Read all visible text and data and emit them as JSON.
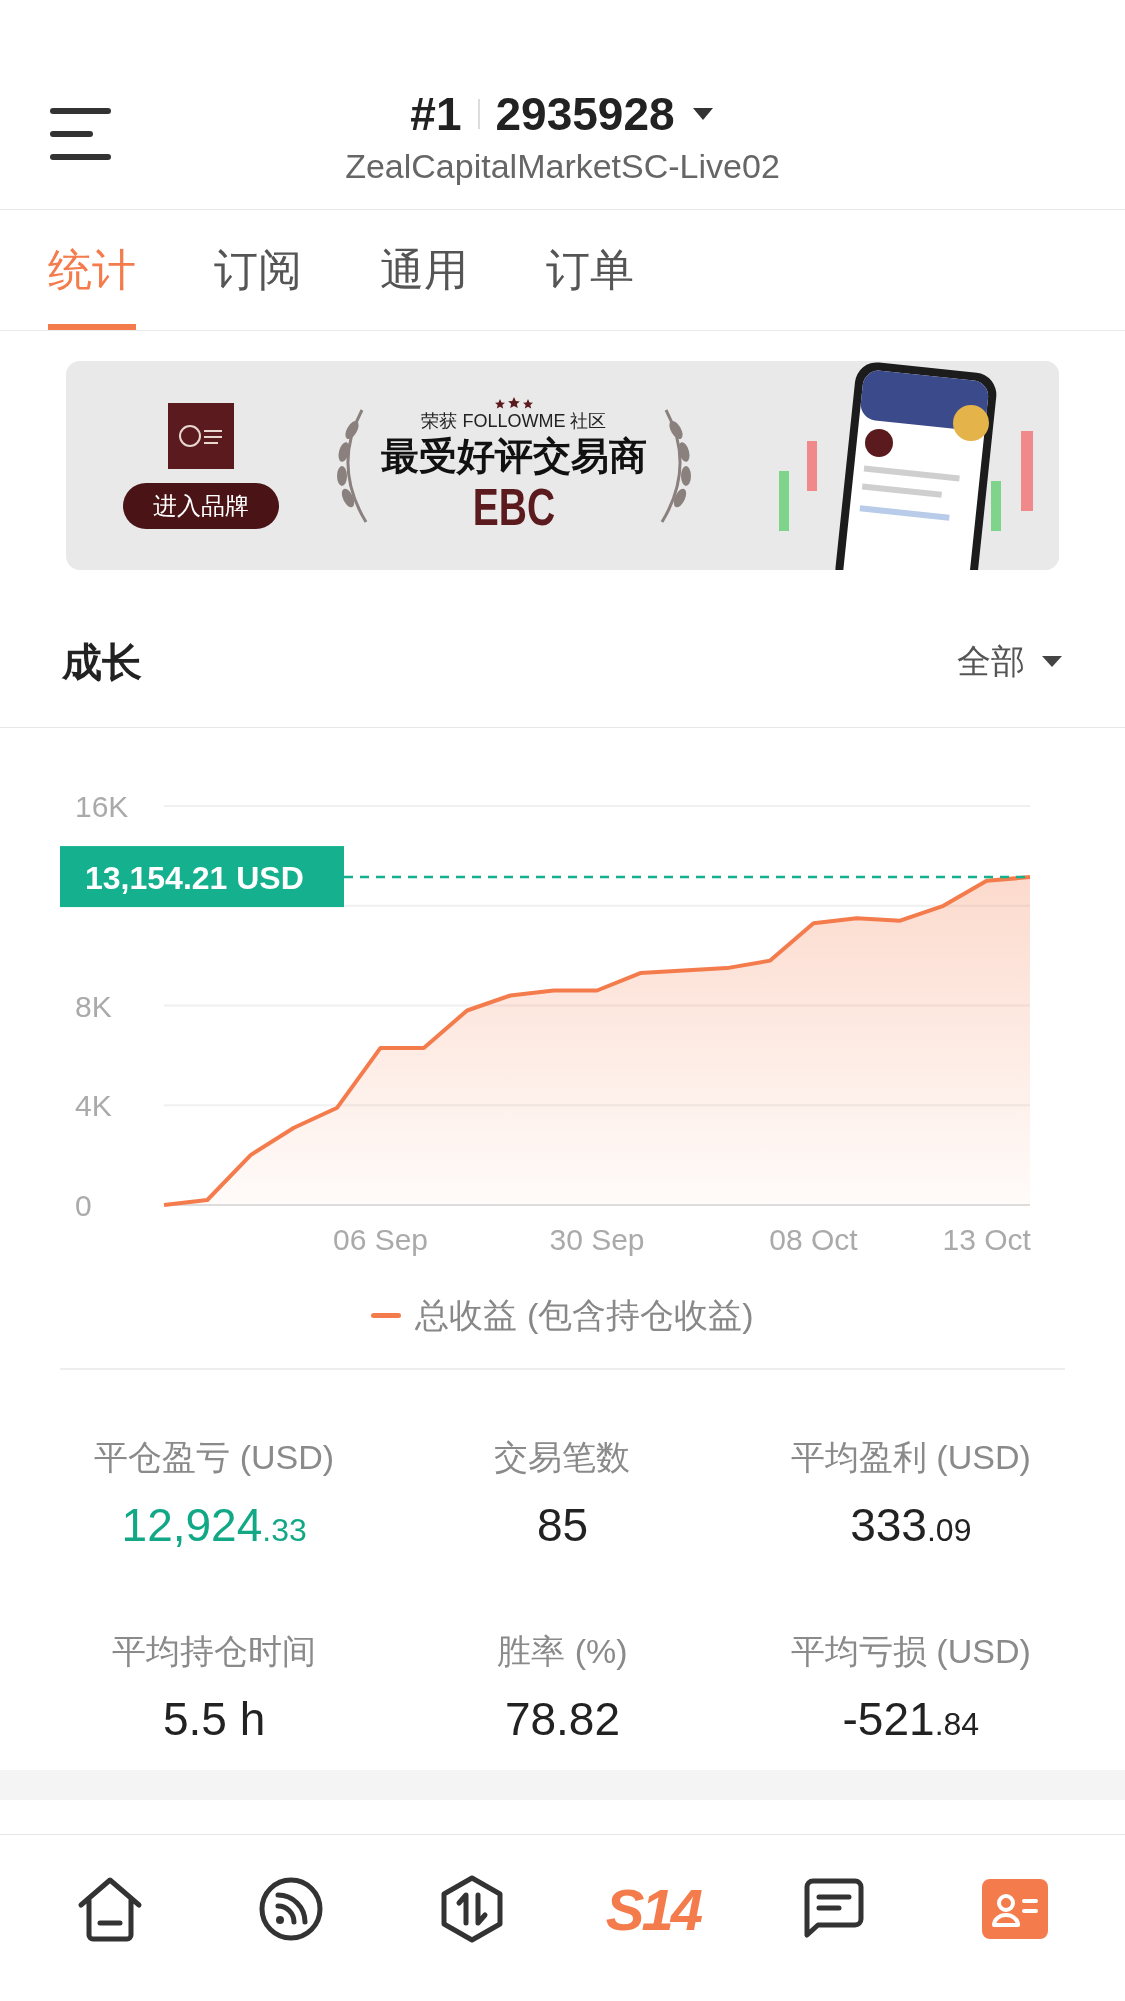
{
  "header": {
    "account_index": "#1",
    "account_number": "2935928",
    "server": "ZealCapitalMarketSC-Live02"
  },
  "tabs": [
    {
      "label": "统计",
      "selected": true
    },
    {
      "label": "订阅",
      "selected": false
    },
    {
      "label": "通用",
      "selected": false
    },
    {
      "label": "订单",
      "selected": false
    }
  ],
  "banner": {
    "button": "进入品牌",
    "award_line": "荣获 FOLLOWME 社区",
    "headline": "最受好评交易商",
    "brand": "EBC"
  },
  "growth": {
    "title": "成长",
    "filter": "全部",
    "current_value": "13,154.21 USD",
    "chart_data": {
      "type": "area",
      "categories": [
        null,
        null,
        null,
        null,
        null,
        "06 Sep",
        null,
        null,
        null,
        null,
        "30 Sep",
        null,
        null,
        null,
        null,
        "08 Oct",
        null,
        null,
        null,
        "13 Oct",
        null
      ],
      "series": [
        {
          "name": "总收益 (包含持仓收益)",
          "color": "#f47c4c",
          "values": [
            0,
            200,
            2000,
            3100,
            3900,
            6300,
            6300,
            7800,
            8400,
            8600,
            8600,
            9300,
            9400,
            9500,
            9800,
            11300,
            11500,
            11400,
            12000,
            13000,
            13150
          ]
        }
      ],
      "ylim": [
        0,
        16000
      ],
      "yticks": [
        {
          "value": 0,
          "label": "0"
        },
        {
          "value": 4000,
          "label": "4K"
        },
        {
          "value": 8000,
          "label": "8K"
        },
        {
          "value": 16000,
          "label": "16K"
        }
      ]
    }
  },
  "stats": [
    {
      "label": "平仓盈亏 (USD)",
      "value": "12,924",
      "decimal": ".33",
      "color": "#12a886"
    },
    {
      "label": "交易笔数",
      "value": "85",
      "color": "#222222"
    },
    {
      "label": "平均盈利 (USD)",
      "value": "333",
      "decimal": ".09",
      "color": "#222222"
    },
    {
      "label": "平均持仓时间",
      "value": "5.5 h",
      "color": "#222222"
    },
    {
      "label": "胜率 (%)",
      "value": "78.82",
      "color": "#222222"
    },
    {
      "label": "平均亏损 (USD)",
      "value": "-521",
      "decimal": ".84",
      "color": "#222222"
    }
  ],
  "bottom_nav": [
    {
      "kind": "home",
      "selected": false
    },
    {
      "kind": "feed",
      "selected": false
    },
    {
      "kind": "trade",
      "selected": false
    },
    {
      "kind": "logo",
      "label": "S14",
      "selected": false
    },
    {
      "kind": "chat",
      "selected": false
    },
    {
      "kind": "profile",
      "selected": true
    }
  ]
}
